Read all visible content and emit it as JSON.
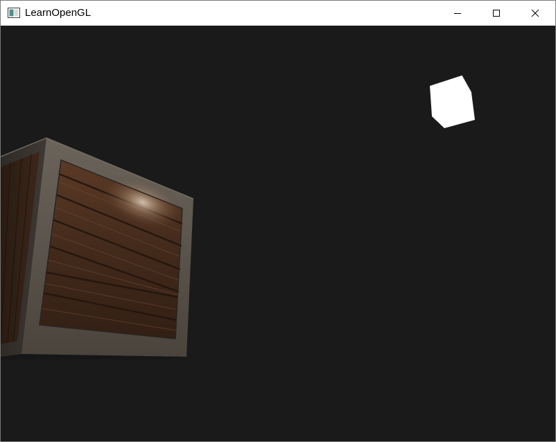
{
  "window": {
    "title": "LearnOpenGL",
    "controls": {
      "minimize": "minimize",
      "maximize": "maximize",
      "close": "close"
    }
  },
  "scene": {
    "background_color": "#1a1a1a",
    "light_cube_color": "#ffffff",
    "crate_wood_color": "#4a2e1c",
    "crate_metal_color": "#5a534a"
  }
}
